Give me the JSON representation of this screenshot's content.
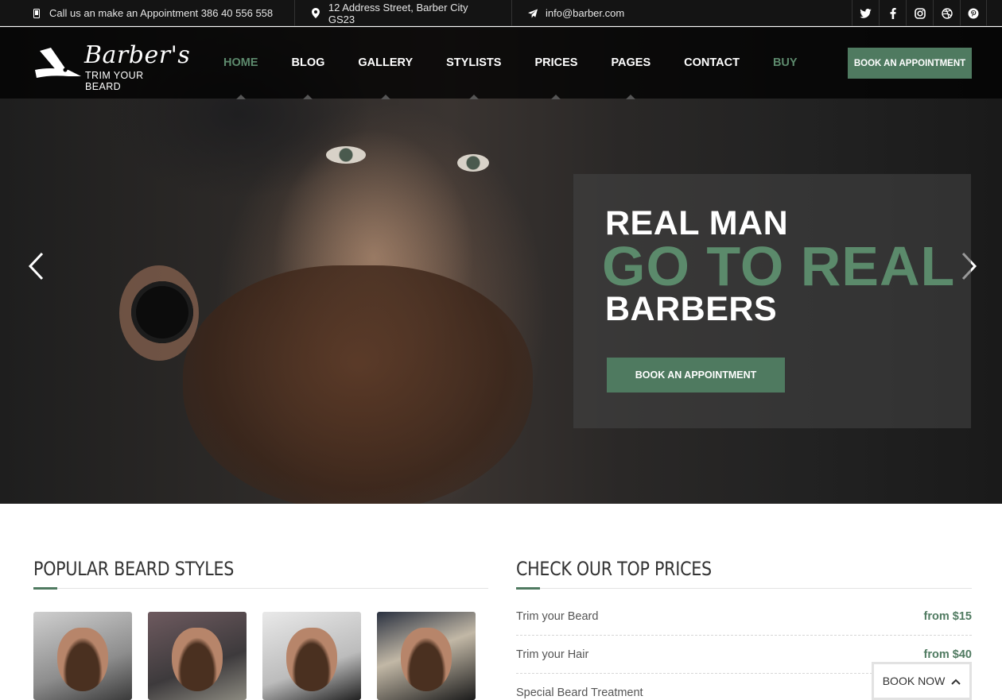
{
  "topbar": {
    "phone": "Call us an make an Appointment 386 40 556 558",
    "address": "12 Address Street, Barber City GS23",
    "email": "info@barber.com",
    "icons": {
      "phone": "mobile-icon",
      "address": "map-pin-icon",
      "email": "paper-plane-icon"
    },
    "socials": [
      "twitter-icon",
      "facebook-icon",
      "instagram-icon",
      "dribbble-icon",
      "pinterest-icon"
    ]
  },
  "logo": {
    "title": "Barber's",
    "tagline": "TRIM YOUR BEARD",
    "icon": "razor-icon"
  },
  "nav": {
    "items": [
      {
        "label": "HOME",
        "active": true
      },
      {
        "label": "BLOG",
        "active": false
      },
      {
        "label": "GALLERY",
        "active": false
      },
      {
        "label": "STYLISTS",
        "active": false
      },
      {
        "label": "PRICES",
        "active": false
      },
      {
        "label": "PAGES",
        "active": false
      },
      {
        "label": "CONTACT",
        "active": false
      },
      {
        "label": "BUY",
        "active": false
      }
    ],
    "cta": "BOOK AN APPOINTMENT"
  },
  "hero": {
    "line1": "REAL MAN",
    "line2": "GO TO REAL",
    "line3": "BARBERS",
    "button": "BOOK AN APPOINTMENT",
    "prev_icon": "chevron-left-icon",
    "next_icon": "chevron-right-icon"
  },
  "beard_styles": {
    "title": "POPULAR BEARD STYLES"
  },
  "prices": {
    "title": "CHECK OUR TOP PRICES",
    "rows": [
      {
        "name": "Trim your Beard",
        "price": "from $15"
      },
      {
        "name": "Trim your Hair",
        "price": "from $40"
      },
      {
        "name": "Special Beard Treatment",
        "price": ""
      }
    ]
  },
  "book_now": {
    "label": "BOOK NOW",
    "icon": "chevron-up-icon"
  },
  "colors": {
    "accent": "#4f7a60",
    "dark": "#141414"
  }
}
